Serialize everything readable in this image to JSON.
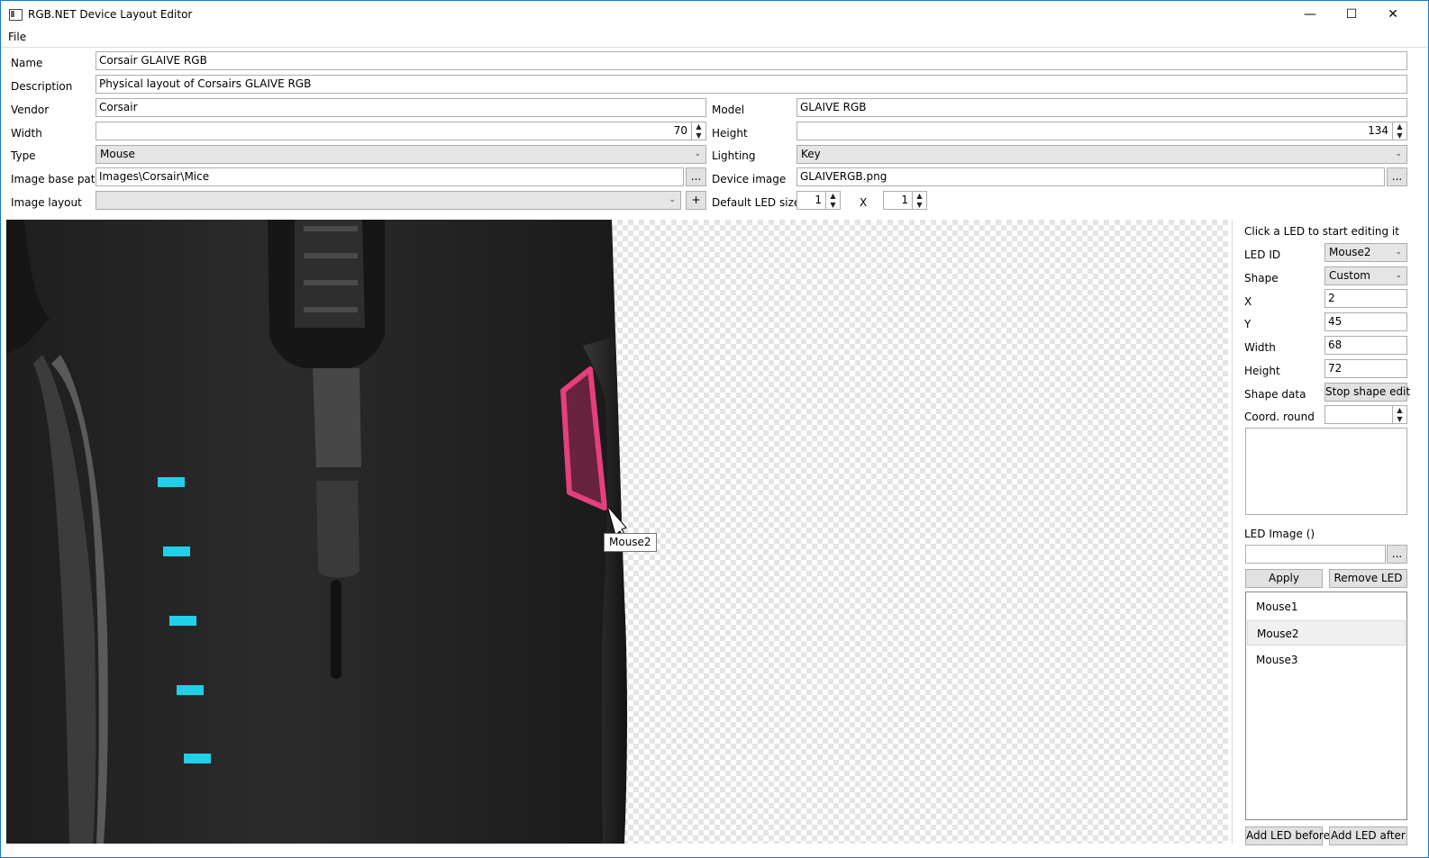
{
  "window": {
    "title": "RGB.NET Device Layout Editor",
    "minimize": "—",
    "maximize": "☐",
    "close": "✕"
  },
  "menu": {
    "file": "File"
  },
  "form": {
    "name_label": "Name",
    "name_value": "Corsair GLAIVE RGB",
    "description_label": "Description",
    "description_value": "Physical layout of Corsairs GLAIVE RGB",
    "vendor_label": "Vendor",
    "vendor_value": "Corsair",
    "model_label": "Model",
    "model_value": "GLAIVE RGB",
    "width_label": "Width",
    "width_value": "70",
    "height_label": "Height",
    "height_value": "134",
    "type_label": "Type",
    "type_value": "Mouse",
    "lighting_label": "Lighting",
    "lighting_value": "Key",
    "image_base_path_label": "Image base path",
    "image_base_path_value": "Images\\Corsair\\Mice",
    "device_image_label": "Device image",
    "device_image_value": "GLAIVERGB.png",
    "image_layout_label": "Image layout",
    "image_layout_value": "",
    "default_led_size_label": "Default LED size",
    "led_size_w": "1",
    "led_size_x": "X",
    "led_size_h": "1",
    "browse": "...",
    "add": "+"
  },
  "canvas": {
    "tooltip": "Mouse2",
    "highlight_color": "#e4407d",
    "led_color": "#1fd0e8"
  },
  "led_panel": {
    "hint": "Click a LED to start editing it",
    "led_id_label": "LED ID",
    "led_id_value": "Mouse2",
    "shape_label": "Shape",
    "shape_value": "Custom",
    "x_label": "X",
    "x_value": "2",
    "y_label": "Y",
    "y_value": "45",
    "width_label": "Width",
    "width_value": "68",
    "height_label": "Height",
    "height_value": "72",
    "shape_data_label": "Shape data",
    "shape_edit_button": "Stop shape edit",
    "coord_round_label": "Coord. round",
    "coord_round_value": "",
    "shape_data_text": "",
    "led_image_label": "LED Image ()",
    "led_image_value": "",
    "browse": "...",
    "apply": "Apply",
    "remove": "Remove LED",
    "leds": [
      "Mouse1",
      "Mouse2",
      "Mouse3"
    ],
    "add_before": "Add LED before",
    "add_after": "Add LED after"
  }
}
